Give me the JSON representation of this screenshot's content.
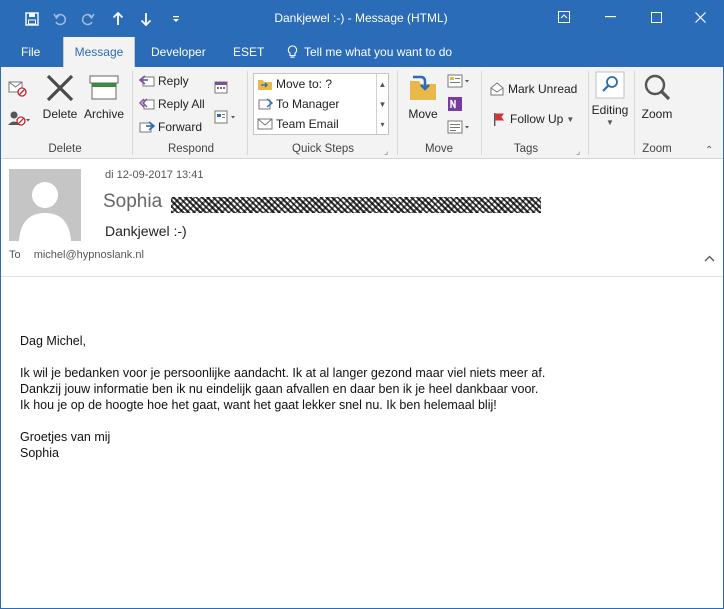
{
  "window": {
    "title": "Dankjewel :-)  -  Message (HTML)"
  },
  "tabs": [
    {
      "label": "File"
    },
    {
      "label": "Message"
    },
    {
      "label": "Developer"
    },
    {
      "label": "ESET"
    },
    {
      "label": "Tell me what you want to do"
    }
  ],
  "ribbon": {
    "delete_group": {
      "label": "Delete",
      "delete": "Delete",
      "archive": "Archive"
    },
    "respond_group": {
      "label": "Respond",
      "reply": "Reply",
      "reply_all": "Reply All",
      "forward": "Forward"
    },
    "quick_steps": {
      "label": "Quick Steps",
      "items": [
        "Move to: ?",
        "To Manager",
        "Team Email"
      ]
    },
    "move_group": {
      "label": "Move",
      "move": "Move"
    },
    "tags_group": {
      "label": "Tags",
      "mark_unread": "Mark Unread",
      "follow_up": "Follow Up"
    },
    "editing_group": {
      "label": "",
      "editing": "Editing"
    },
    "zoom_group": {
      "label": "Zoom",
      "zoom": "Zoom"
    }
  },
  "message": {
    "date": "di 12-09-2017 13:41",
    "sender": "Sophia",
    "subject": "Dankjewel :-)",
    "to_label": "To",
    "to": "michel@hypnoslank.nl",
    "body": {
      "greeting": "Dag Michel,",
      "line1": "Ik wil je bedanken voor je persoonlijke aandacht. Ik at al langer gezond maar viel niets meer af.",
      "line2": "Dankzij jouw informatie ben ik nu eindelijk gaan afvallen en daar ben ik je heel dankbaar voor.",
      "line3": "Ik hou je op de hoogte hoe het gaat, want het gaat lekker snel nu. Ik ben helemaal blij!",
      "closing": "Groetjes van mij",
      "signature": "Sophia"
    }
  }
}
